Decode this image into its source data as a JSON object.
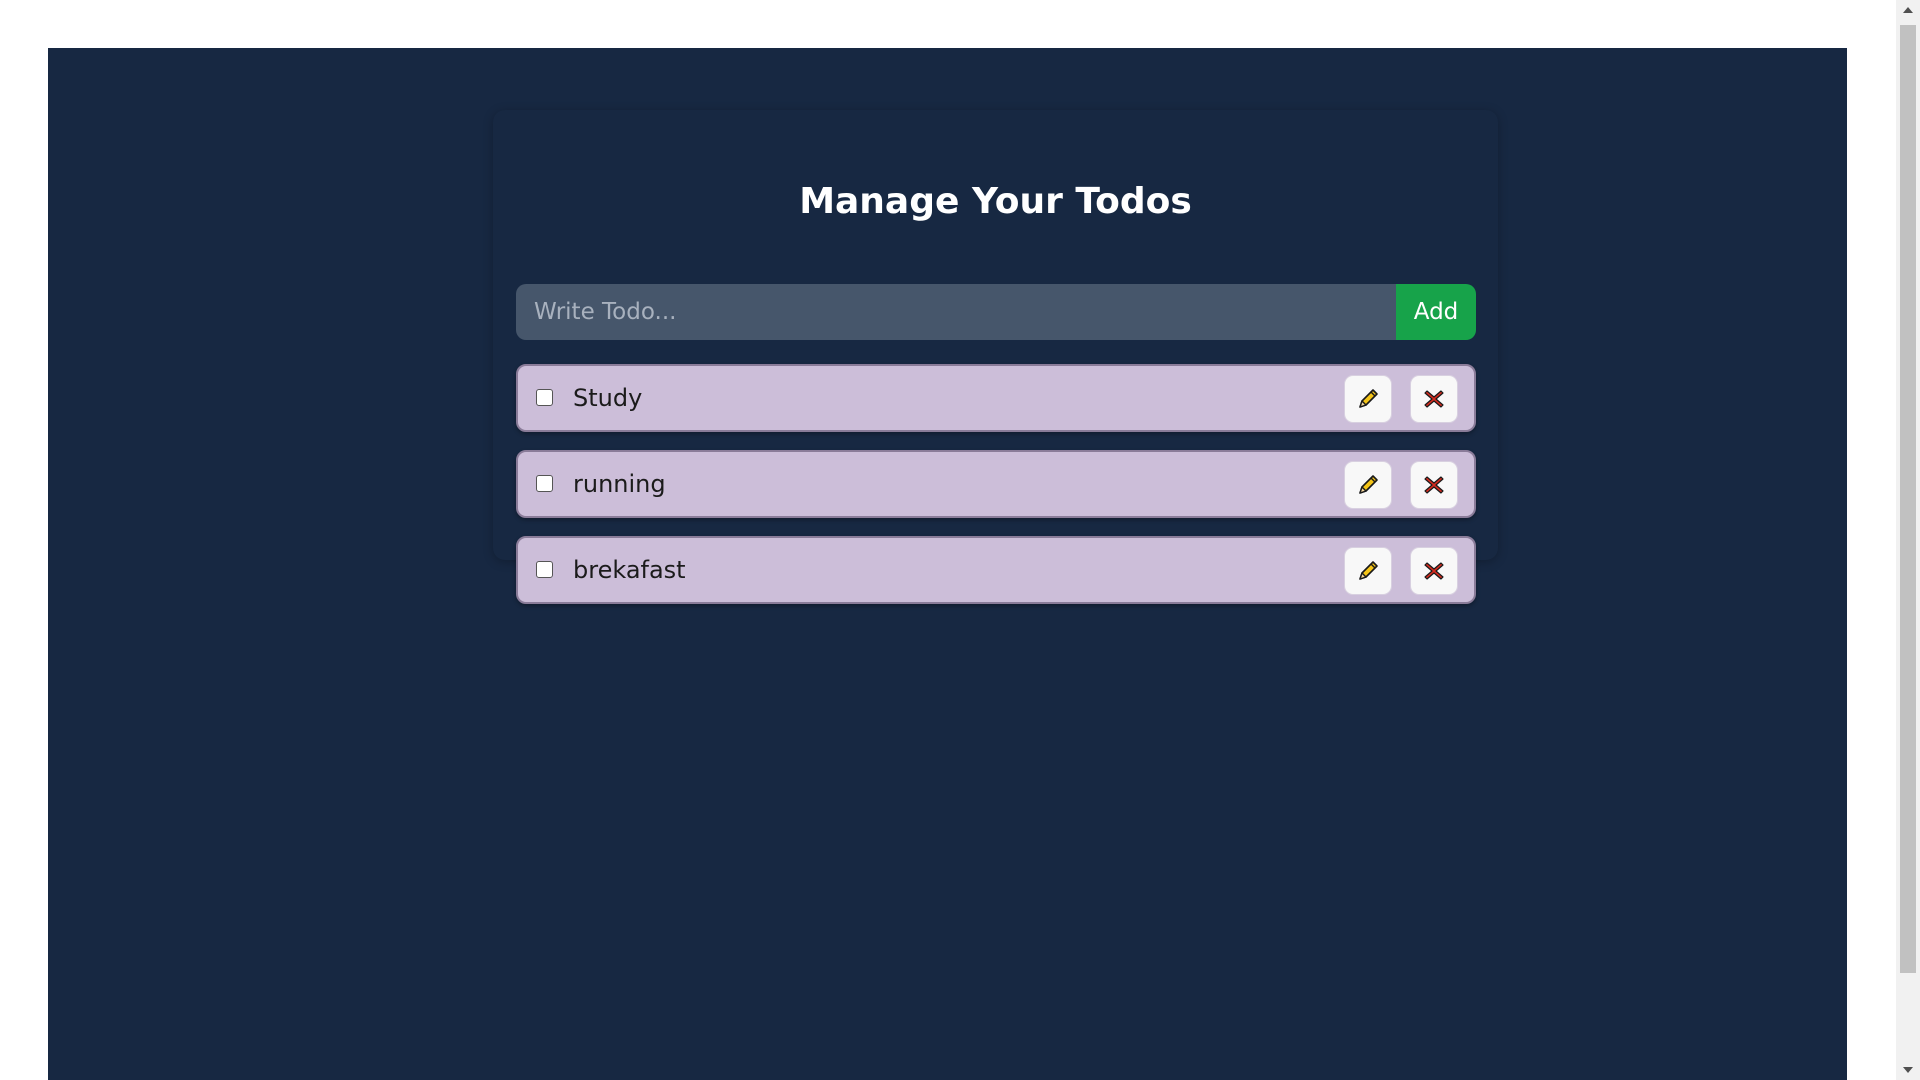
{
  "page": {
    "title": "Manage Your Todos"
  },
  "input": {
    "placeholder": "Write Todo...",
    "value": ""
  },
  "add_button": {
    "label": "Add"
  },
  "todos": [
    {
      "text": "Study",
      "completed": false
    },
    {
      "text": "running",
      "completed": false
    },
    {
      "text": "brekafast",
      "completed": false
    }
  ],
  "icons": {
    "edit": "pencil-icon",
    "delete": "close-icon"
  },
  "colors": {
    "background": "#172842",
    "input_bg": "#46566b",
    "add_button": "#17a34a",
    "todo_item": "#ccbed9",
    "edit_icon": "#f5c518",
    "delete_icon": "#d62b1f"
  }
}
